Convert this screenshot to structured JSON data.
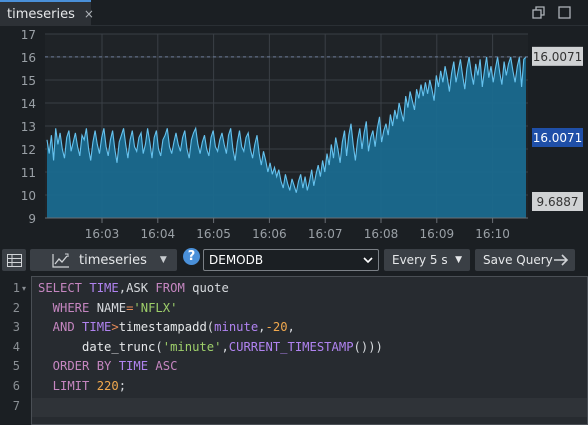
{
  "tab": {
    "label": "timeseries",
    "close": "×"
  },
  "toolbar": {
    "chart_type_label": "timeseries",
    "help_label": "?",
    "database": "DEMODB",
    "refresh_label": "Every 5 s",
    "save_label": "Save Query"
  },
  "editor": {
    "line_numbers": [
      "1",
      "2",
      "3",
      "4",
      "5",
      "6",
      "7"
    ],
    "lines": [
      [
        {
          "t": "SELECT ",
          "c": "kw"
        },
        {
          "t": "TIME",
          "c": "kw2"
        },
        {
          "t": ",",
          "c": ""
        },
        {
          "t": "ASK",
          "c": ""
        },
        {
          "t": " FROM ",
          "c": "kw"
        },
        {
          "t": "quote",
          "c": ""
        }
      ],
      [
        {
          "t": "  WHERE ",
          "c": "kw"
        },
        {
          "t": "NAME",
          "c": ""
        },
        {
          "t": "=",
          "c": "op"
        },
        {
          "t": "'NFLX'",
          "c": "str"
        }
      ],
      [
        {
          "t": "  AND ",
          "c": "kw"
        },
        {
          "t": "TIME",
          "c": "kw2"
        },
        {
          "t": ">",
          "c": "op"
        },
        {
          "t": "timestampadd",
          "c": "fn"
        },
        {
          "t": "(",
          "c": ""
        },
        {
          "t": "minute",
          "c": "kw2"
        },
        {
          "t": ",",
          "c": ""
        },
        {
          "t": "-20",
          "c": "num"
        },
        {
          "t": ",",
          "c": ""
        }
      ],
      [
        {
          "t": "      date_trunc",
          "c": "fn"
        },
        {
          "t": "(",
          "c": ""
        },
        {
          "t": "'minute'",
          "c": "str"
        },
        {
          "t": ",",
          "c": ""
        },
        {
          "t": "CURRENT_TIMESTAMP",
          "c": "kw2"
        },
        {
          "t": "()))",
          "c": ""
        }
      ],
      [
        {
          "t": "  ORDER BY ",
          "c": "kw"
        },
        {
          "t": "TIME",
          "c": "kw2"
        },
        {
          "t": " ASC",
          "c": "kw"
        }
      ],
      [
        {
          "t": "  LIMIT ",
          "c": "kw"
        },
        {
          "t": "220",
          "c": "num"
        },
        {
          "t": ";",
          "c": ""
        }
      ],
      []
    ]
  },
  "chart_data": {
    "type": "area",
    "series": [
      {
        "values": [
          12.4,
          11.8,
          12.6,
          11.5,
          12.9,
          12.2,
          12.7,
          12.0,
          11.6,
          12.5,
          12.8,
          11.9,
          12.3,
          12.7,
          12.1,
          11.7,
          12.6,
          12.4,
          12.9,
          12.0,
          11.5,
          12.3,
          12.8,
          12.2,
          11.8,
          12.5,
          12.9,
          12.1,
          11.7,
          12.4,
          12.8,
          12.0,
          11.4,
          12.3,
          12.6,
          12.9,
          12.2,
          11.6,
          12.4,
          12.8,
          12.1,
          11.9,
          12.5,
          12.7,
          11.8,
          12.2,
          12.9,
          12.3,
          11.6,
          12.5,
          12.8,
          12.0,
          11.7,
          12.4,
          12.6,
          12.9,
          12.1,
          11.8,
          12.3,
          12.7,
          12.2,
          11.9,
          12.5,
          12.8,
          12.0,
          11.6,
          12.4,
          12.7,
          12.9,
          12.2,
          11.8,
          12.3,
          12.6,
          12.0,
          11.7,
          12.5,
          12.8,
          12.1,
          11.9,
          12.4,
          12.7,
          12.2,
          11.8,
          12.6,
          12.9,
          12.0,
          11.5,
          12.3,
          12.8,
          12.1,
          11.9,
          12.5,
          12.7,
          12.0,
          11.6,
          12.2,
          12.6,
          11.8,
          11.3,
          11.9,
          11.5,
          11.0,
          11.4,
          10.9,
          11.2,
          10.8,
          11.1,
          10.6,
          10.3,
          10.9,
          10.5,
          10.2,
          10.7,
          10.4,
          10.1,
          10.6,
          10.9,
          10.3,
          10.8,
          10.2,
          10.6,
          11.1,
          10.4,
          10.9,
          11.3,
          10.8,
          11.5,
          11.0,
          11.8,
          11.3,
          12.2,
          11.6,
          12.5,
          12.0,
          11.4,
          12.3,
          12.8,
          11.7,
          12.6,
          13.1,
          12.2,
          11.5,
          12.4,
          12.9,
          12.0,
          12.7,
          13.2,
          11.9,
          12.5,
          12.8,
          12.1,
          12.9,
          13.4,
          12.3,
          12.8,
          13.1,
          12.6,
          13.5,
          13.0,
          13.7,
          13.3,
          14.0,
          13.6,
          13.2,
          14.3,
          13.8,
          14.5,
          14.1,
          13.7,
          14.6,
          14.2,
          14.8,
          14.3,
          14.9,
          14.4,
          15.0,
          14.6,
          14.1,
          15.2,
          14.7,
          15.4,
          14.9,
          15.6,
          15.1,
          14.5,
          15.3,
          15.8,
          14.9,
          15.4,
          15.9,
          15.2,
          14.6,
          15.5,
          16.0,
          15.3,
          14.8,
          15.7,
          15.2,
          15.9,
          14.7,
          15.4,
          16.0,
          15.1,
          15.6,
          14.9,
          15.5,
          16.0,
          15.3,
          14.8,
          15.8,
          15.2,
          15.7,
          16.0,
          15.4,
          14.9,
          15.6,
          16.0,
          14.7,
          15.9,
          16.0
        ]
      }
    ],
    "ylim": [
      9,
      17
    ],
    "yticks": [
      "9",
      "10",
      "11",
      "12",
      "13",
      "14",
      "15",
      "16",
      "17"
    ],
    "xticks": [
      "16:03",
      "16:04",
      "16:05",
      "16:06",
      "16:07",
      "16:08",
      "16:09",
      "16:10"
    ],
    "labels": {
      "max": "16.0071",
      "last": "16.0071",
      "min": "9.6887"
    },
    "max_line_value": 16.0071,
    "colors": {
      "fill": "#1a6a8e",
      "line": "#66c2ee",
      "last_badge": "#1f4fa8",
      "grid": "#3a3f45"
    }
  }
}
